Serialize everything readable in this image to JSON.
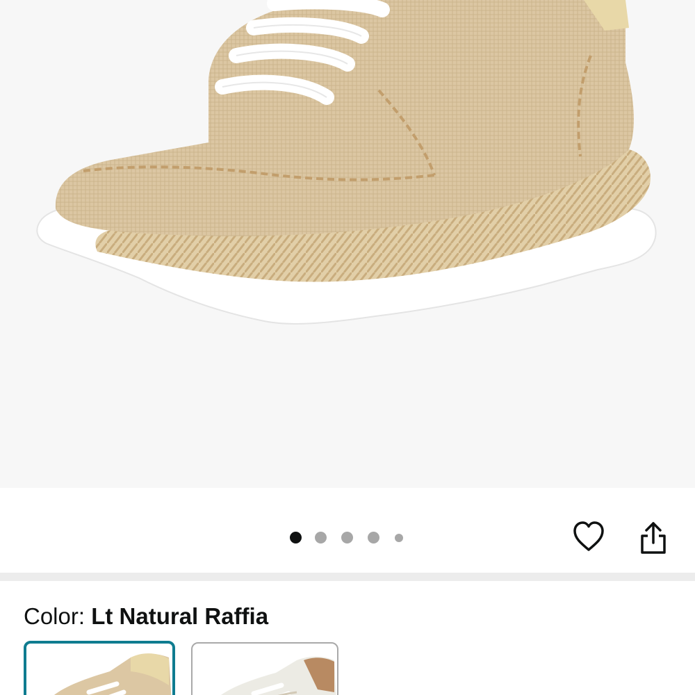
{
  "product": {
    "images_total": 5,
    "active_image_index": 0
  },
  "actions": {
    "wishlist_icon": "heart-outline-icon",
    "share_icon": "share-icon"
  },
  "color": {
    "label": "Color: ",
    "value": "Lt Natural Raffia",
    "options": [
      {
        "name": "Lt Natural Raffia",
        "selected": true
      },
      {
        "name": "",
        "selected": false
      }
    ]
  },
  "colors": {
    "accent_selected_border": "#0f7c90",
    "hero_background": "#f7f7f7",
    "dot_active": "#0f1111",
    "dot_inactive": "#a7a7a7"
  }
}
